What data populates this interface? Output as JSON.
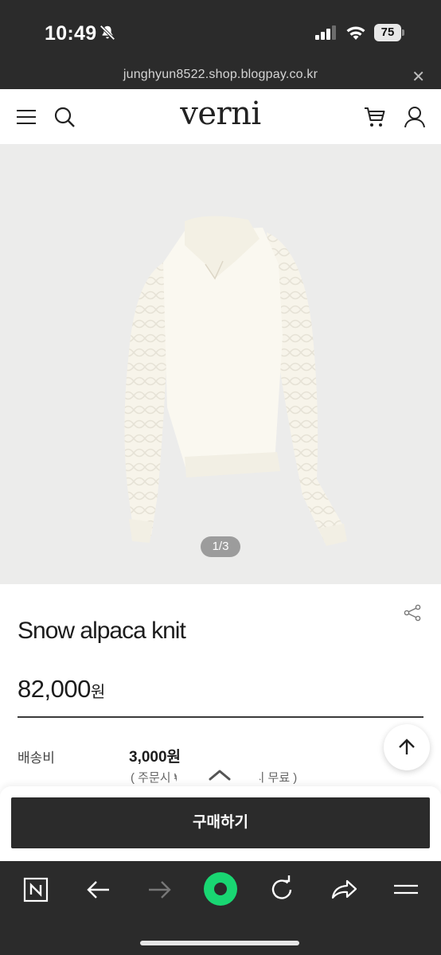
{
  "status_bar": {
    "time": "10:49",
    "battery": "75"
  },
  "browser": {
    "url": "junghyun8522.shop.blogpay.co.kr",
    "close_label": "✕"
  },
  "header": {
    "brand": "verni",
    "icons": [
      "menu-icon",
      "search-icon",
      "cart-icon",
      "user-icon"
    ]
  },
  "product": {
    "image_indicator": "1/3",
    "title": "Snow alpaca knit",
    "price": "82,000",
    "price_unit": "원",
    "shipping_label": "배송비",
    "shipping_value": "3,000원",
    "shipping_note": "( 주문시 ₩        원 이상 구매 시 무료 )"
  },
  "actions": {
    "buy_label": "구매하기"
  },
  "bottom_bar": {
    "items": [
      "naver-n-icon",
      "back-arrow-icon",
      "forward-arrow-icon",
      "green-home-icon",
      "reload-icon",
      "share-icon",
      "menu-icon"
    ]
  },
  "colors": {
    "dark_bar": "#2b2b2b",
    "accent_green": "#19d672",
    "image_bg": "#ececeb"
  }
}
